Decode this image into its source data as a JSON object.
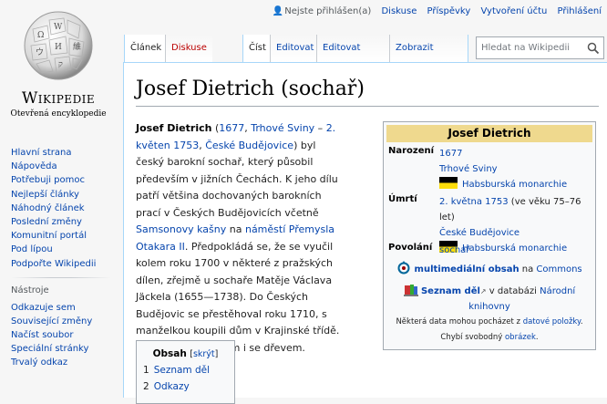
{
  "personal": {
    "not_logged_in": "Nejste přihlášen(a)",
    "discussion": "Diskuse",
    "contributions": "Příspěvky",
    "create_account": "Vytvoření účtu",
    "log_in": "Přihlášení"
  },
  "logo": {
    "wordmark": "Wikipedie",
    "tagline": "Otevřená encyklopedie"
  },
  "sidebar": {
    "nav": [
      "Hlavní strana",
      "Nápověda",
      "Potřebuji pomoc",
      "Nejlepší články",
      "Náhodný článek",
      "Poslední změny",
      "Komunitní portál",
      "Pod lípou",
      "Podpořte Wikipedii"
    ],
    "tools_heading": "Nástroje",
    "tools": [
      "Odkazuje sem",
      "Související změny",
      "Načíst soubor",
      "Speciální stránky",
      "Trvalý odkaz"
    ]
  },
  "tabs": {
    "article": "Článek",
    "discussion": "Diskuse",
    "read": "Číst",
    "edit": "Editovat",
    "edit_source": "Editovat zdroj",
    "history": "Zobrazit historii"
  },
  "search": {
    "placeholder": "Hledat na Wikipedii"
  },
  "article": {
    "title": "Josef Dietrich (sochař)",
    "lead": {
      "name": "Josef Dietrich",
      "p1": " (",
      "birth_year": "1677",
      "p2": ", ",
      "birth_place": "Trhové Sviny",
      "p3": " – ",
      "death_date": "2. květen 1753",
      "p4": ", ",
      "death_place": "České Budějovice",
      "p5": ") byl český barokní sochař, který působil především v jižních Čechách. K jeho dílu patří většina dochovaných barokních prací v Českých Budějovicích včetně ",
      "link_kasna": "Samsonovy kašny",
      "p6": " na ",
      "link_namesti": "náměstí Přemysla Otakara II",
      "p7": ". Předpokládá se, že se vyučil kolem roku 1700 v některé z pražských dílen, zřejmě u sochaře Matěje Václava Jäckela (1655—1738). Do Českých Budějovic se přestěhoval roku 1710, s manželkou koupili dům v Krajinské třídě. Pracoval s kamenem i se dřevem."
    },
    "toc": {
      "title": "Obsah",
      "toggle": "skrýt",
      "items": [
        {
          "num": "1",
          "label": "Seznam děl"
        },
        {
          "num": "2",
          "label": "Odkazy"
        }
      ]
    }
  },
  "infobox": {
    "title": "Josef Dietrich",
    "born_label": "Narození",
    "born_year": "1677",
    "born_place": "Trhové Sviny",
    "born_state": "Habsburská monarchie",
    "died_label": "Úmrtí",
    "died_date": "2. května 1753",
    "died_age": " (ve věku 75–76 let)",
    "died_place": "České Budějovice",
    "died_state": "Habsburská monarchie",
    "occupation_label": "Povolání",
    "occupation": "sochař",
    "commons_link": "multimediální obsah",
    "commons_on": " na ",
    "commons_name": "Commons",
    "works_link": "Seznam děl",
    "works_in": " v databázi ",
    "works_db": "Národní knihovny",
    "footnote1_pre": "Některá data mohou pocházet z ",
    "footnote1_link": "datové položky",
    "footnote1_post": ".",
    "footnote2_pre": "Chybí svobodný ",
    "footnote2_link": "obrázek",
    "footnote2_post": "."
  }
}
